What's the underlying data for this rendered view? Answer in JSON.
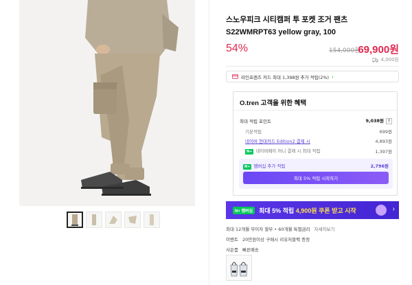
{
  "product": {
    "title": "스노우피크 시티캠퍼 투 포켓 조거 팬츠 S22WMRPT63 yellow gray, 100",
    "discount_rate": "54%",
    "original_price": "154,000원",
    "sale_price": "69,900원",
    "shipping_fee": "4,000원"
  },
  "card_banner": {
    "text": "라인프렌즈 카드 최대 1,398원 추가 적립(2%)",
    "arrow": "›"
  },
  "benefits": {
    "title": "O.tren 고객을 위한 혜택",
    "max_points_label": "최대 적립 포인트",
    "max_points_value": "9,038원",
    "help": "?",
    "basic_label": "기본적립",
    "basic_value": "699원",
    "card_label": "네이버 현대카드 Edition2 결제 시",
    "card_value": "4,893원",
    "npay_label": "네이버페이 머니 결제 시 최대 적립",
    "npay_value": "1,397원",
    "member_label": "멤버십 추가 적립",
    "member_value": "2,796원",
    "member_button": "최대 5% 적립 시작하기",
    "npay_badge": "N+"
  },
  "promo": {
    "badge": "N+ 멤버십",
    "text_prefix": "최대 5% 적립 ",
    "text_highlight": "4,900원 쿠폰 받고 시작",
    "arrow": "›"
  },
  "meta": {
    "installment": "최대 12개월 무이자 할부 • 60개월 특별금리",
    "installment_more": "자세히보기",
    "event_label": "이벤트",
    "event_text": "20만원이상 구매시 리유저블백 증정",
    "gift_label": "사은품",
    "gift_text": "빠른배송"
  },
  "colors": {
    "accent_red": "#e0284f",
    "purple": "#5b3fd6",
    "naver_green": "#03c75a"
  }
}
